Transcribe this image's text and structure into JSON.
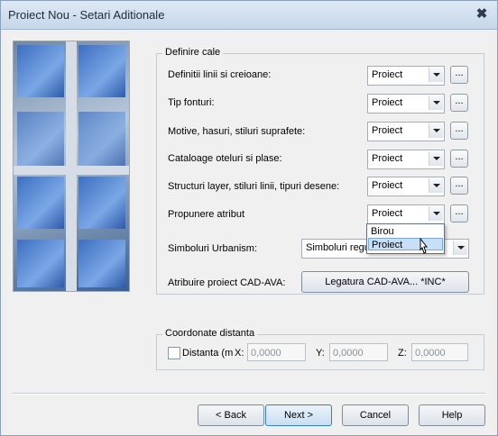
{
  "window": {
    "title": "Proiect Nou - Setari Aditionale",
    "close_glyph": "✖"
  },
  "definire": {
    "group_title": "Definire cale",
    "rows": [
      {
        "label": "Definitii linii si creioane:",
        "value": "Proiect"
      },
      {
        "label": "Tip fonturi:",
        "value": "Proiect"
      },
      {
        "label": "Motive, hasuri, stiluri suprafete:",
        "value": "Proiect"
      },
      {
        "label": "Cataloage oteluri si plase:",
        "value": "Proiect"
      },
      {
        "label": "Structuri layer, stiluri linii, tipuri desene:",
        "value": "Proiect"
      },
      {
        "label": "Propunere atribut",
        "value": "Proiect"
      }
    ],
    "browse_label": "...",
    "dropdown_options": [
      "Birou",
      "Proiect"
    ],
    "simboluri_label": "Simboluri Urbanism:",
    "simboluri_value": "Simboluri regulament. Romania",
    "atribuire_label": "Atribuire proiect CAD-AVA:",
    "atribuire_button": "Legatura CAD-AVA... *INC*"
  },
  "coordonate": {
    "group_title": "Coordonate distanta",
    "checkbox_label": "Distanta (m",
    "x_label": "X:",
    "x_value": "0,0000",
    "y_label": "Y:",
    "y_value": "0,0000",
    "z_label": "Z:",
    "z_value": "0,0000"
  },
  "buttons": {
    "back": "< Back",
    "next": "Next >",
    "cancel": "Cancel",
    "help": "Help"
  }
}
